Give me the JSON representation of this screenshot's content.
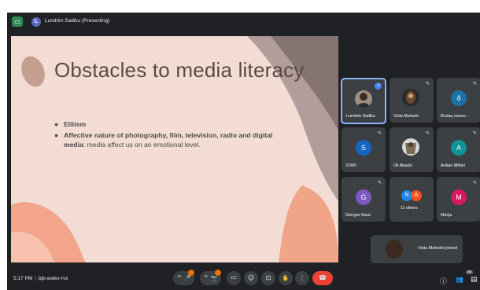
{
  "topbar": {
    "app_icon": "present-screen-icon",
    "presenter_initial": "L",
    "title": "Lundrim Sadiku (Presenting)"
  },
  "slide": {
    "title": "Obstacles to media literacy",
    "bullets": [
      {
        "bold": "Elitism",
        "rest": ""
      },
      {
        "bold": "Affective nature of photography, film, television, radio and digital media",
        "rest": ": media affect us on an emotional level."
      }
    ],
    "bullet_glyph": "●",
    "colors": {
      "background": "#f3dcd3",
      "accent": "#f2a58a",
      "text": "#5a4a46"
    }
  },
  "participants": [
    {
      "name": "Lundrim Sadiku",
      "type": "photo",
      "speaking": true
    },
    {
      "name": "Viola Metoshi",
      "type": "photo",
      "muted": true
    },
    {
      "name": "Волиц vюско...",
      "initial": "ð",
      "color": "#1a73a8",
      "muted": true
    },
    {
      "name": "STAN",
      "initial": "S",
      "color": "#1565c0",
      "muted": true
    },
    {
      "name": "Oli Abadzi",
      "type": "photo",
      "muted": true
    },
    {
      "name": "Ardian Miftari",
      "initial": "A",
      "color": "#12939a",
      "muted": true
    },
    {
      "name": "Giorgos Sisut",
      "initial": "G",
      "color": "#7e57c2",
      "muted": true
    },
    {
      "name": "11 others",
      "initials": [
        "N",
        "A"
      ],
      "muted": false
    },
    {
      "name": "Marija",
      "initial": "M",
      "color": "#d81b60",
      "muted": true
    }
  ],
  "notification": {
    "text": "Viola Metoshi joined"
  },
  "bottombar": {
    "time": "5:17 PM",
    "separator": "|",
    "meeting_code": "bjb-wwkv-rvx",
    "people_count": "20",
    "icons": {
      "mic_chevron": "^",
      "cam_chevron": "^",
      "mic": "🎤",
      "cam": "📷",
      "captions": "CC",
      "emoji": "☺",
      "present": "⊡",
      "hand": "✋",
      "more": "⋮",
      "end": "☎",
      "info": "ⓘ",
      "people": "👥",
      "chat": "▤"
    }
  }
}
